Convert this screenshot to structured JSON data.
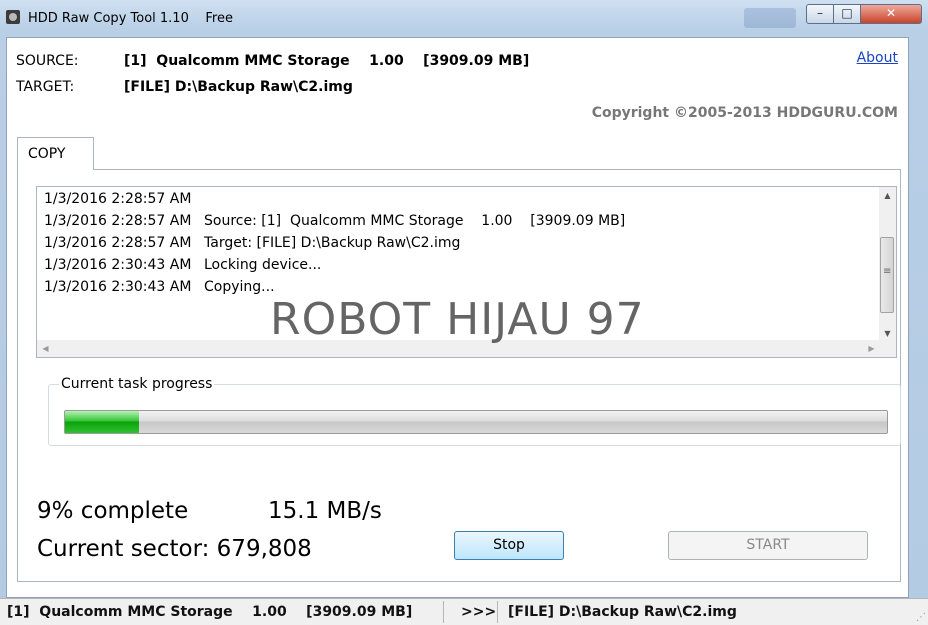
{
  "window": {
    "title": "HDD Raw Copy Tool 1.10    Free",
    "min_glyph": "–",
    "max_glyph": "□",
    "close_glyph": "✕"
  },
  "header": {
    "source_label": "SOURCE:",
    "source_value": "[1]  Qualcomm MMC Storage    1.00    [3909.09 MB]",
    "target_label": "TARGET:",
    "target_value": "[FILE] D:\\Backup Raw\\C2.img",
    "about_link": "About",
    "copyright": "Copyright ©2005-2013 HDDGURU.COM"
  },
  "tabs": [
    {
      "label": "COPY"
    }
  ],
  "log": {
    "lines": [
      {
        "time": "1/3/2016 2:28:57 AM",
        "msg": ""
      },
      {
        "time": "1/3/2016 2:28:57 AM",
        "msg": "Source: [1]  Qualcomm MMC Storage    1.00    [3909.09 MB]"
      },
      {
        "time": "1/3/2016 2:28:57 AM",
        "msg": "Target: [FILE] D:\\Backup Raw\\C2.img"
      },
      {
        "time": "1/3/2016 2:30:43 AM",
        "msg": "Locking device..."
      },
      {
        "time": "1/3/2016 2:30:43 AM",
        "msg": "Copying..."
      }
    ]
  },
  "watermark": "ROBOT HIJAU 97",
  "progress": {
    "group_label": "Current task progress",
    "percent": 9,
    "complete_text": "9% complete",
    "speed_text": "15.1 MB/s",
    "sector_text": "Current sector: 679,808"
  },
  "buttons": {
    "stop_label": "Stop",
    "start_label": "START"
  },
  "statusbar": {
    "source": "[1]  Qualcomm MMC Storage    1.00    [3909.09 MB]",
    "arrow": ">>>",
    "target": "[FILE] D:\\Backup Raw\\C2.img"
  },
  "colors": {
    "progress_fill": "#0aa20a",
    "link": "#1a44c2",
    "close_button": "#c8432b"
  }
}
